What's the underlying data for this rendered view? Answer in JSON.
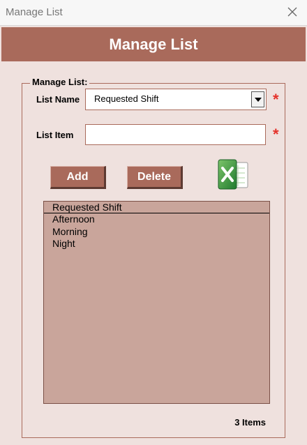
{
  "window": {
    "title": "Manage List"
  },
  "banner": {
    "title": "Manage List"
  },
  "form": {
    "group_label": "Manage List:",
    "list_name_label": "List Name",
    "list_name_value": "Requested Shift",
    "list_item_label": "List Item",
    "list_item_value": "",
    "required_marker": "*"
  },
  "buttons": {
    "add_label": "Add",
    "delete_label": "Delete"
  },
  "listbox": {
    "header": "Requested Shift",
    "items": [
      "Afternoon",
      "Morning",
      "Night"
    ]
  },
  "status": {
    "count_text": "3 Items"
  },
  "colors": {
    "accent": "#a96a5b",
    "background": "#efe1de",
    "list_bg": "#c9a59b",
    "required": "#e4322b"
  },
  "icons": {
    "close": "close-icon",
    "dropdown": "chevron-down-icon",
    "excel": "excel-icon"
  }
}
